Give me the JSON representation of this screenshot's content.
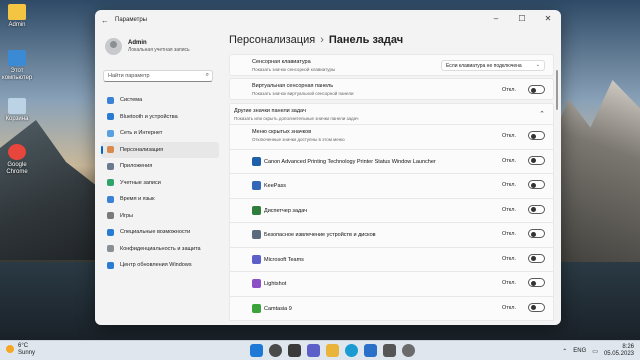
{
  "desktop": {
    "icons": [
      {
        "label": "Admin",
        "icon": "folder-user-icon",
        "color": "#f4c542"
      },
      {
        "label": "Этот компьютер",
        "icon": "computer-icon",
        "color": "#3a8ad6"
      },
      {
        "label": "Корзина",
        "icon": "recycle-bin-icon",
        "color": "#bcd3e6"
      },
      {
        "label": "Google Chrome",
        "icon": "chrome-icon",
        "color": "#e8453c"
      }
    ]
  },
  "window": {
    "app_title": "Параметры",
    "user": {
      "name": "Admin",
      "subtitle": "Локальная учетная запись"
    },
    "search_placeholder": "Найти параметр",
    "nav": [
      {
        "label": "Система",
        "icon": "system-icon",
        "color": "#3b82d6"
      },
      {
        "label": "Bluetooth и устройства",
        "icon": "bluetooth-icon",
        "color": "#2a7bd3"
      },
      {
        "label": "Сеть и Интернет",
        "icon": "network-icon",
        "color": "#5a9fe0"
      },
      {
        "label": "Персонализация",
        "icon": "brush-icon",
        "color": "#d9894a",
        "active": true
      },
      {
        "label": "Приложения",
        "icon": "apps-icon",
        "color": "#6b7a8c"
      },
      {
        "label": "Учетные записи",
        "icon": "account-icon",
        "color": "#2ea36a"
      },
      {
        "label": "Время и язык",
        "icon": "clock-globe-icon",
        "color": "#3b82d6"
      },
      {
        "label": "Игры",
        "icon": "gamepad-icon",
        "color": "#7a7a7a"
      },
      {
        "label": "Специальные возможности",
        "icon": "accessibility-icon",
        "color": "#2a7bd3"
      },
      {
        "label": "Конфиденциальность и защита",
        "icon": "shield-icon",
        "color": "#8a8f96"
      },
      {
        "label": "Центр обновления Windows",
        "icon": "update-icon",
        "color": "#2a7bd3"
      }
    ],
    "breadcrumb": {
      "parent": "Персонализация",
      "separator": "›",
      "current": "Панель задач"
    },
    "top_rows": [
      {
        "title": "Сенсорная клавиатура",
        "subtitle": "Показать значок сенсорной клавиатуры",
        "dropdown": "Если клавиатура не подключена"
      },
      {
        "title": "Виртуальная сенсорная панель",
        "subtitle": "Показать значок виртуальной сенсорной панели",
        "state": "Откл."
      }
    ],
    "section": {
      "title": "Другие значки панели задач",
      "subtitle": "Показать или скрыть дополнительные значки панели задач",
      "rows": [
        {
          "title": "Меню скрытых значков",
          "subtitle": "Отключенные значки доступны в этом меню",
          "state": "Откл."
        },
        {
          "title": "Canon Advanced Printing Technology Printer Status Window Launcher",
          "state": "Откл.",
          "icon": "canon-printer-icon",
          "color": "#1f5fa8"
        },
        {
          "title": "KeePass",
          "state": "Откл.",
          "icon": "keepass-icon",
          "color": "#3467b8"
        },
        {
          "title": "Диспетчер задач",
          "state": "Откл.",
          "icon": "task-manager-icon",
          "color": "#2f7d3b"
        },
        {
          "title": "Безопасное извлечение устройств и дисков",
          "state": "Откл.",
          "icon": "usb-eject-icon",
          "color": "#5b6b7c"
        },
        {
          "title": "Microsoft Teams",
          "state": "Откл.",
          "icon": "teams-icon",
          "color": "#5b5fc7"
        },
        {
          "title": "Lightshot",
          "state": "Откл.",
          "icon": "lightshot-icon",
          "color": "#8c4fc6"
        },
        {
          "title": "Camtasia 9",
          "state": "Откл.",
          "icon": "camtasia-icon",
          "color": "#3ba33b"
        }
      ]
    }
  },
  "taskbar": {
    "weather": {
      "temp": "6°C",
      "condition": "Sunny"
    },
    "language": "ENG",
    "time": "8:26",
    "date": "05.05.2023",
    "apps": [
      {
        "icon": "start-icon",
        "color": "#1e78d6"
      },
      {
        "icon": "search-icon",
        "color": "#4a4a4a"
      },
      {
        "icon": "task-view-icon",
        "color": "#3a3a3a"
      },
      {
        "icon": "teams-chat-icon",
        "color": "#5b5fc7"
      },
      {
        "icon": "file-explorer-icon",
        "color": "#e8b53a"
      },
      {
        "icon": "edge-icon",
        "color": "#1a9bd1"
      },
      {
        "icon": "store-icon",
        "color": "#2a70c9"
      },
      {
        "icon": "calculator-icon",
        "color": "#555555"
      },
      {
        "icon": "settings-gear-icon",
        "color": "#6b6b6b"
      }
    ]
  }
}
